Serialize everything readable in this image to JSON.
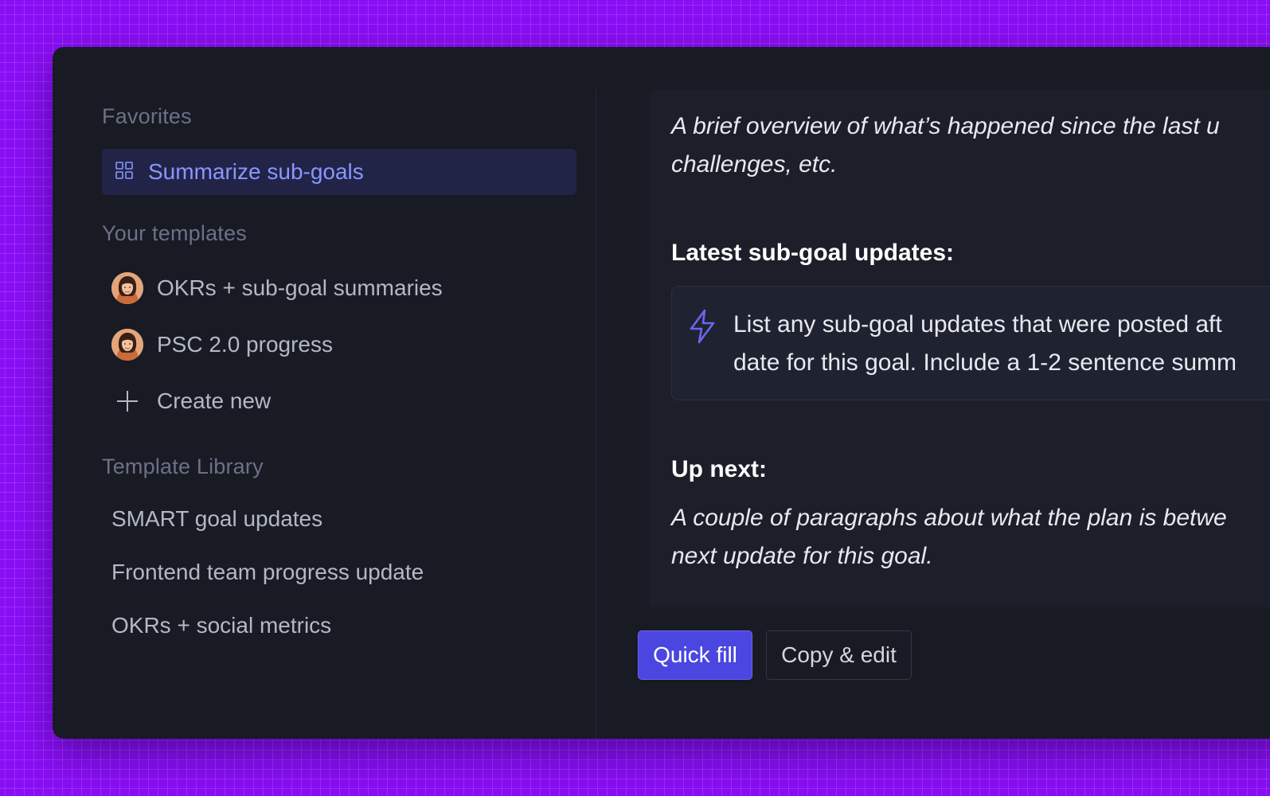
{
  "sidebar": {
    "favorites": {
      "title": "Favorites",
      "items": [
        {
          "label": "Summarize sub-goals",
          "icon": "grid-icon",
          "selected": true
        }
      ]
    },
    "your_templates": {
      "title": "Your templates",
      "items": [
        {
          "label": "OKRs + sub-goal summaries",
          "icon": "avatar"
        },
        {
          "label": "PSC 2.0 progress",
          "icon": "avatar"
        }
      ],
      "create_new": {
        "label": "Create new",
        "icon": "plus-icon"
      }
    },
    "template_library": {
      "title": "Template Library",
      "items": [
        {
          "label": "SMART goal updates"
        },
        {
          "label": "Frontend team progress update"
        },
        {
          "label": "OKRs + social metrics"
        }
      ]
    }
  },
  "preview": {
    "intro_line1": "A brief overview of what’s happened since the last u",
    "intro_line2": "challenges, etc.",
    "latest_heading": "Latest sub-goal updates:",
    "prompt_line1": "List any sub-goal updates that were posted aft",
    "prompt_line2": "date for this goal. Include a 1-2 sentence summ",
    "prompt_icon": "lightning-icon",
    "up_next_heading": "Up next:",
    "up_next_line1": "A couple of paragraphs about what the plan is betwe",
    "up_next_line2": "next update for this goal."
  },
  "actions": {
    "quick_fill": "Quick fill",
    "copy_edit": "Copy & edit"
  },
  "colors": {
    "background": "#8a0ef5",
    "panel": "#181a24",
    "accent": "#4b46e0",
    "selected_text": "#8a96ff",
    "selected_bg": "#212447"
  }
}
